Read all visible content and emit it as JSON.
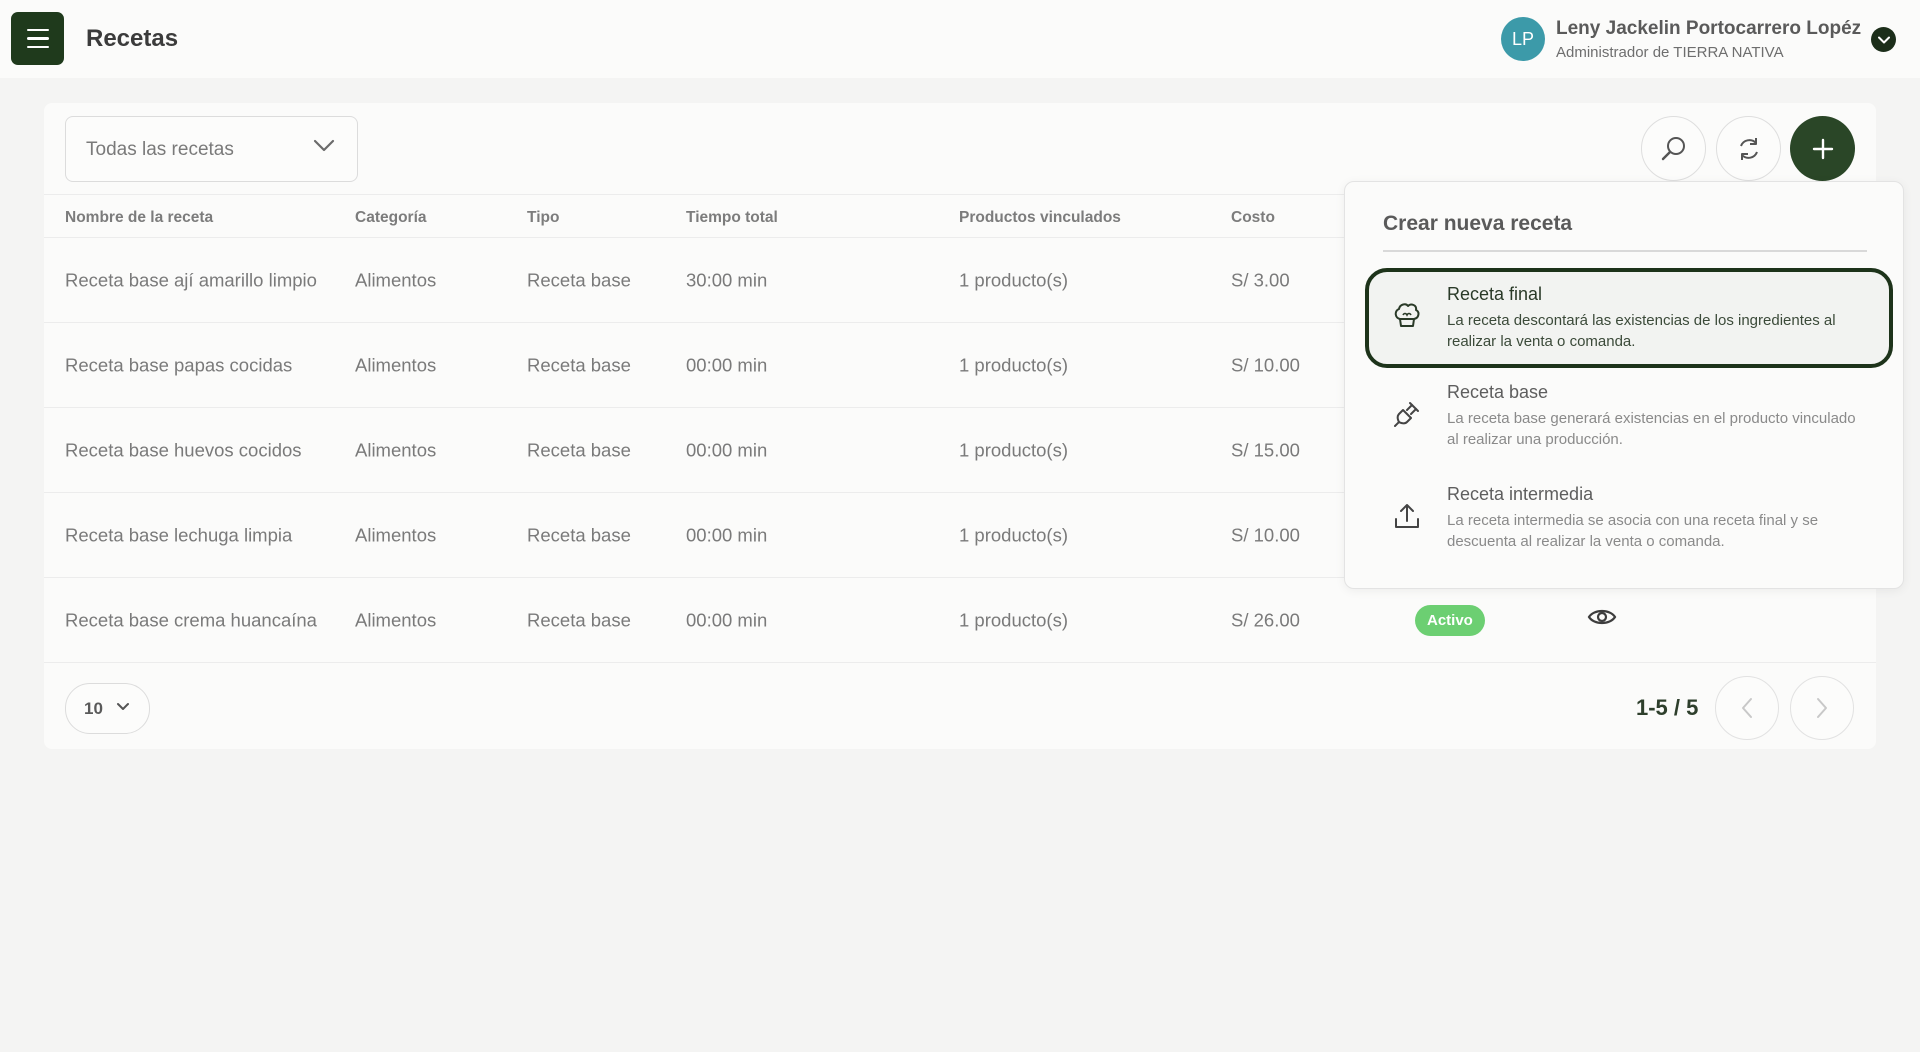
{
  "header": {
    "title": "Recetas",
    "user": {
      "initials": "LP",
      "name": "Leny Jackelin Portocarrero Lopéz",
      "role": "Administrador de TIERRA NATIVA"
    }
  },
  "toolbar": {
    "filter_value": "Todas las recetas"
  },
  "table": {
    "columns": [
      "Nombre de la receta",
      "Categoría",
      "Tipo",
      "Tiempo total",
      "Productos vinculados",
      "Costo"
    ],
    "rows": [
      {
        "name": "Receta base ají amarillo limpio",
        "category": "Alimentos",
        "type": "Receta base",
        "time": "30:00 min",
        "products": "1 producto(s)",
        "cost": "S/ 3.00"
      },
      {
        "name": "Receta base papas cocidas",
        "category": "Alimentos",
        "type": "Receta base",
        "time": "00:00 min",
        "products": "1 producto(s)",
        "cost": "S/ 10.00"
      },
      {
        "name": "Receta base huevos cocidos",
        "category": "Alimentos",
        "type": "Receta base",
        "time": "00:00 min",
        "products": "1 producto(s)",
        "cost": "S/ 15.00"
      },
      {
        "name": "Receta base lechuga limpia",
        "category": "Alimentos",
        "type": "Receta base",
        "time": "00:00 min",
        "products": "1 producto(s)",
        "cost": "S/ 10.00"
      },
      {
        "name": "Receta base crema huancaína",
        "category": "Alimentos",
        "type": "Receta base",
        "time": "00:00 min",
        "products": "1 producto(s)",
        "cost": "S/ 26.00",
        "status": "Activo"
      }
    ]
  },
  "pagination": {
    "page_size": "10",
    "range": "1-5 / 5"
  },
  "create_menu": {
    "title": "Crear nueva receta",
    "options": [
      {
        "title": "Receta final",
        "description": "La receta descontará las existencias de los ingredientes al realizar la venta o comanda.",
        "icon": "chef-hat-icon"
      },
      {
        "title": "Receta base",
        "description": "La receta base generará existencias en el producto vinculado al realizar una producción.",
        "icon": "plug-icon"
      },
      {
        "title": "Receta intermedia",
        "description": "La receta intermedia se asocia con una receta final y se descuenta al realizar la venta o comanda.",
        "icon": "upload-icon"
      }
    ]
  },
  "colors": {
    "brand_dark_green": "#1f3a1c",
    "status_active": "#6ccf72",
    "avatar": "#3c9aa9"
  }
}
